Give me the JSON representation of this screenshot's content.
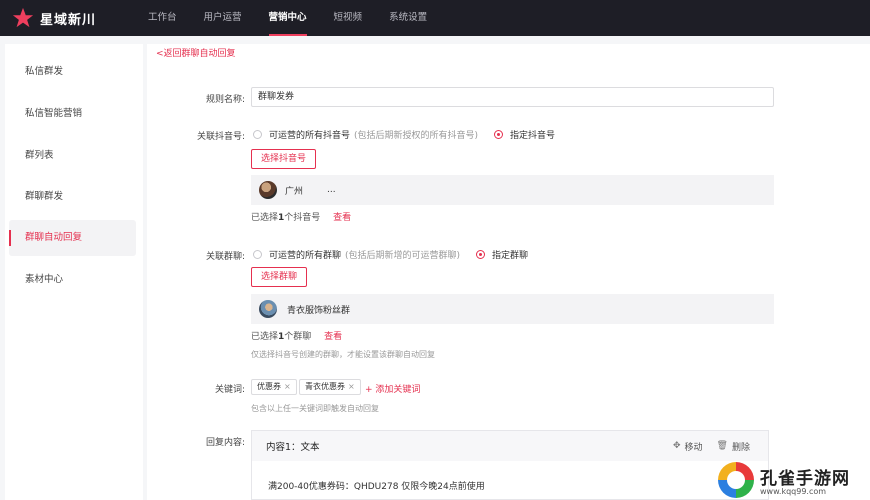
{
  "app": {
    "title": "星域新川"
  },
  "nav": [
    {
      "label": "工作台",
      "active": false
    },
    {
      "label": "用户运营",
      "active": false
    },
    {
      "label": "营销中心",
      "active": true
    },
    {
      "label": "短视频",
      "active": false
    },
    {
      "label": "系统设置",
      "active": false
    }
  ],
  "sidebar": {
    "items": [
      {
        "label": "私信群发"
      },
      {
        "label": "私信智能营销"
      },
      {
        "label": "群列表"
      },
      {
        "label": "群聊群发"
      },
      {
        "label": "群聊自动回复",
        "active": true
      },
      {
        "label": "素材中心"
      }
    ]
  },
  "back": {
    "label": "返回群聊自动回复"
  },
  "rule_name": {
    "label": "规则名称:",
    "value": "群聊发券"
  },
  "account": {
    "label": "关联抖音号:",
    "option_all": "可运营的所有抖音号",
    "option_all_hint": "(包括后期新授权的所有抖音号)",
    "option_specific": "指定抖音号",
    "select_button": "选择抖音号",
    "selected_name": "广州",
    "selected_suffix": "...",
    "count_text": "已选择",
    "count_value": "1",
    "count_unit": "个抖音号",
    "view_link": "查看"
  },
  "group": {
    "label": "关联群聊:",
    "option_all": "可运营的所有群聊",
    "option_all_hint": "(包括后期新增的可运营群聊)",
    "option_specific": "指定群聊",
    "select_button": "选择群聊",
    "selected_name": "青衣服饰粉丝群",
    "count_text": "已选择",
    "count_value": "1",
    "count_unit": "个群聊",
    "view_link": "查看",
    "hint": "仅选择抖音号创建的群聊，才能设置该群聊自动回复"
  },
  "keywords": {
    "label": "关键词:",
    "tags": [
      "优惠券",
      "青衣优惠券"
    ],
    "add_label": "+ 添加关键词",
    "hint": "包含以上任一关键词即触发自动回复"
  },
  "reply": {
    "label": "回复内容:",
    "title": "内容1：文本",
    "move": "移动",
    "delete": "删除",
    "body": "满200-40优惠券码：QHDU278 仅限今晚24点前使用"
  },
  "watermark": {
    "title": "孔雀手游网",
    "sub": "www.kqq99.com"
  },
  "colors": {
    "accent": "#e5304f",
    "topbar": "#1e1e26"
  }
}
